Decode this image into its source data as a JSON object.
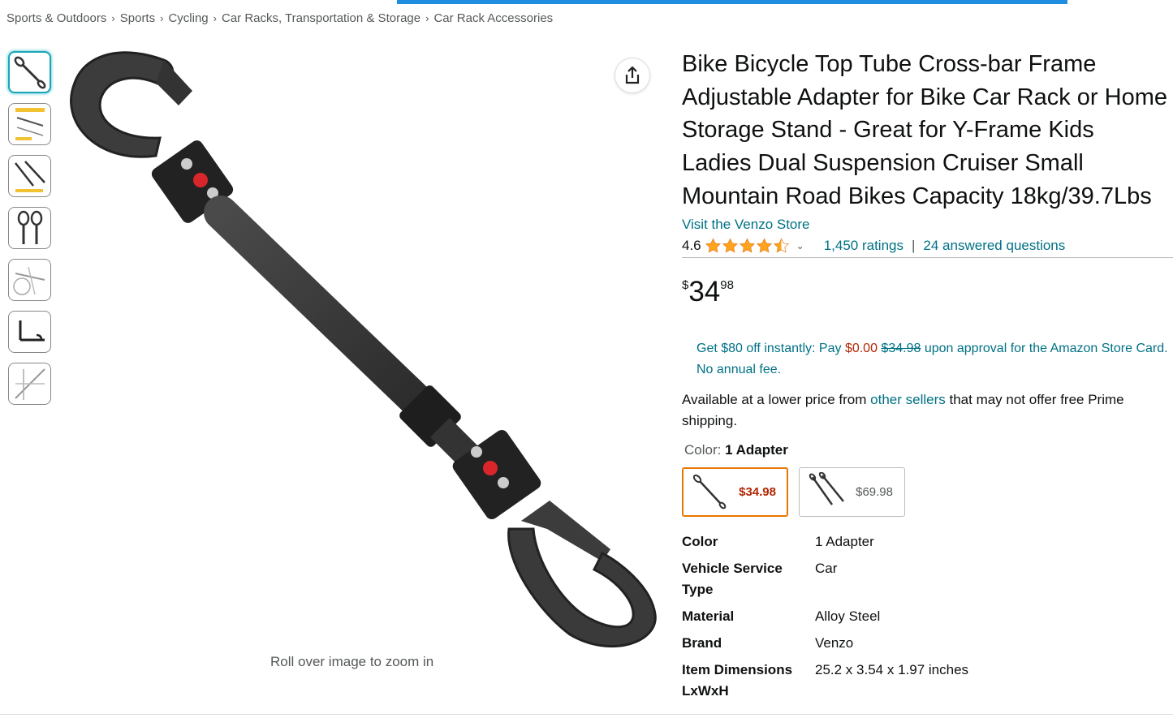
{
  "breadcrumb": [
    "Sports & Outdoors",
    "Sports",
    "Cycling",
    "Car Racks, Transportation & Storage",
    "Car Rack Accessories"
  ],
  "breadcrumb_separator": "›",
  "gallery": {
    "thumbnail_count": 7,
    "selected_index": 0,
    "zoom_hint": "Roll over image to zoom in"
  },
  "product": {
    "title": "Bike Bicycle Top Tube Cross-bar Frame Adjustable Adapter for Bike Car Rack or Home Storage Stand - Great for Y-Frame Kids Ladies Dual Suspension Cruiser Small Mountain Road Bikes Capacity 18kg/39.7Lbs",
    "store_link": "Visit the Venzo Store",
    "rating": "4.6",
    "rating_stars": 4.5,
    "ratings_count": "1,450 ratings",
    "questions": "24 answered questions",
    "price": {
      "symbol": "$",
      "whole": "34",
      "fraction": "98"
    }
  },
  "promo": {
    "part1": "Get $80 off instantly: Pay",
    "pay_amount": "$0.00",
    "strike_amount": "$34.98",
    "part2": "upon approval for the Amazon Store Card. No annual fee."
  },
  "availability": {
    "prefix": "Available at a lower price from",
    "link": "other sellers",
    "suffix": "that may not offer free Prime shipping."
  },
  "color": {
    "label": "Color:",
    "selected": "1 Adapter",
    "options": [
      {
        "price": "$34.98",
        "selected": true
      },
      {
        "price": "$69.98",
        "selected": false
      }
    ]
  },
  "specs": [
    {
      "key": "Color",
      "value": "1 Adapter"
    },
    {
      "key": "Vehicle Service Type",
      "value": "Car"
    },
    {
      "key": "Material",
      "value": "Alloy Steel"
    },
    {
      "key": "Brand",
      "value": "Venzo"
    },
    {
      "key": "Item Dimensions LxWxH",
      "value": "25.2 x 3.54 x 1.97 inches"
    }
  ],
  "colors": {
    "link": "#007185",
    "price_red": "#b12704",
    "star": "#ffa41c",
    "selected_swatch": "#e77600",
    "top_bar": "#1f8ee0"
  }
}
